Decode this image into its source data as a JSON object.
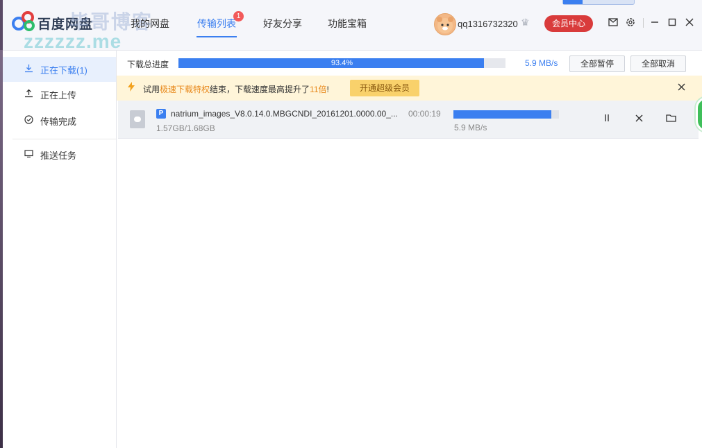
{
  "app": {
    "brand": "百度网盘",
    "watermark_top": "毕哥博客",
    "watermark_url": "zzzzzz.me"
  },
  "nav": {
    "tabs": [
      {
        "label": "我的网盘",
        "active": false
      },
      {
        "label": "传输列表",
        "active": true,
        "badge": "1"
      },
      {
        "label": "好友分享",
        "active": false
      },
      {
        "label": "功能宝箱",
        "active": false
      }
    ]
  },
  "user": {
    "name": "qq1316732320",
    "vip_button": "会员中心"
  },
  "sidebar": {
    "items": [
      {
        "label": "正在下载(1)",
        "icon": "download-icon",
        "active": true
      },
      {
        "label": "正在上传",
        "icon": "upload-icon",
        "active": false
      },
      {
        "label": "传输完成",
        "icon": "check-circle-icon",
        "active": false
      },
      {
        "label": "推送任务",
        "icon": "monitor-icon",
        "active": false
      }
    ]
  },
  "progress": {
    "label": "下载总进度",
    "percent": 93.4,
    "percent_text": "93.4%",
    "speed": "5.9 MB/s",
    "pause_all": "全部暂停",
    "cancel_all": "全部取消"
  },
  "promo": {
    "prefix": "试用",
    "highlight1": "极速下载特权",
    "middle": "结束，下载速度最高提升了",
    "highlight2": "11倍",
    "suffix": "!",
    "button": "开通超级会员"
  },
  "downloads": [
    {
      "tag": "P",
      "name": "natrium_images_V8.0.14.0.MBGCNDI_20161201.0000.00_...",
      "size": "1.57GB/1.68GB",
      "time_left": "00:00:19",
      "progress": 0.93,
      "speed": "5.9 MB/s"
    }
  ],
  "colors": {
    "accent": "#3b7ff0",
    "vip": "#d93b3b",
    "promo_bg": "#fff5d9",
    "promo_highlight": "#e8891c"
  }
}
